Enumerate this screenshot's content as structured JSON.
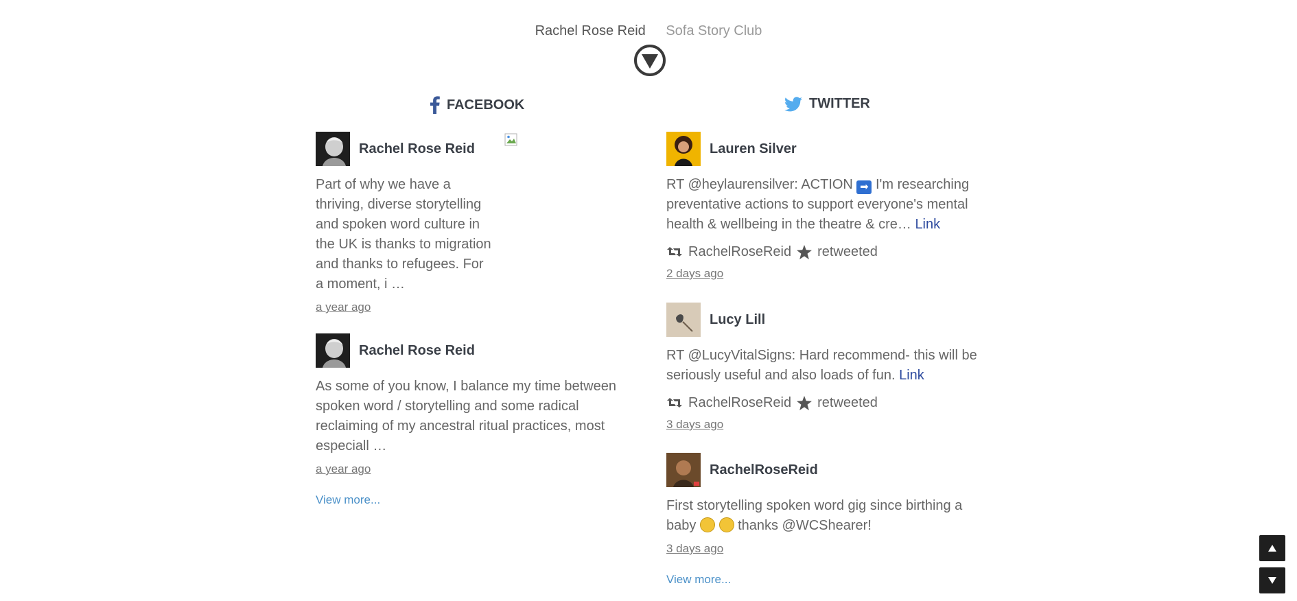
{
  "nav": {
    "primary": "Rachel Rose Reid",
    "secondary": "Sofa Story Club"
  },
  "facebook": {
    "heading": "FACEBOOK",
    "posts": [
      {
        "author": "Rachel Rose Reid",
        "text": "Part of why we have a thriving, diverse storytelling and spoken word culture in the UK is thanks to migration and thanks to refugees. For a moment, i …",
        "time": "a year ago"
      },
      {
        "author": "Rachel Rose Reid",
        "text": "As some of you know, I balance my time between spoken word / storytelling and some radical reclaiming of my ancestral ritual practices, most especiall …",
        "time": "a year ago"
      }
    ],
    "view_more": "View more..."
  },
  "twitter": {
    "heading": "TWITTER",
    "posts": [
      {
        "author": "Lauren Silver",
        "text_a": "RT @heylaurensilver: ACTION",
        "arrow_glyph": "➡",
        "text_b": "I'm researching preventative actions to support everyone's mental health & wellbeing in the theatre & cre…",
        "link": "Link",
        "retweeter": "RachelRoseReid",
        "retweeted": "retweeted",
        "time": "2 days ago"
      },
      {
        "author": "Lucy Lill",
        "text": "RT @LucyVitalSigns: Hard recommend- this will be seriously useful and also loads of fun.",
        "link": "Link",
        "retweeter": "RachelRoseReid",
        "retweeted": "retweeted",
        "time": "3 days ago"
      },
      {
        "author": "RachelRoseReid",
        "text_a": "First storytelling spoken word gig since birthing a baby",
        "text_b": "thanks @WCShearer!",
        "time": "3 days ago"
      }
    ],
    "view_more": "View more..."
  },
  "colors": {
    "facebook": "#3b5998",
    "twitter": "#1da1f2",
    "link": "#2d4a9e",
    "view_more": "#4a90c8"
  }
}
